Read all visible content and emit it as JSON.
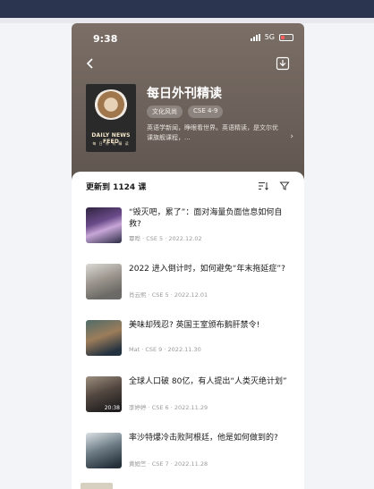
{
  "status_bar": {
    "time": "9:38",
    "network": "5G"
  },
  "book": {
    "title": "每日外刊精读",
    "tags": [
      "文化风尚",
      "CSE 4-9"
    ],
    "description": "英语学新闻，睁眼看世界。英语精读，是文尔优课旗舰课程，...",
    "cover_line1": "DAILY NEWS FEED",
    "cover_line2": "每 日 外 刊 精 读"
  },
  "sheet": {
    "update_label": "更新到 1124 课"
  },
  "episodes": [
    {
      "title": "“毁灭吧，累了”：面对海量负面信息如何自救?",
      "author": "覃晔",
      "level": "CSE 5",
      "date": "2022.12.02",
      "duration": ""
    },
    {
      "title": "2022 进入倒计时，如何避免“年末拖延症”?",
      "author": "肖云熙",
      "level": "CSE 5",
      "date": "2022.12.01",
      "duration": ""
    },
    {
      "title": "美味却残忍? 英国王室颁布鹅肝禁令!",
      "author": "Mat",
      "level": "CSE 9",
      "date": "2022.11.30",
      "duration": ""
    },
    {
      "title": "全球人口破 80亿，有人提出“人类灭绝计划”",
      "author": "李婷婷",
      "level": "CSE 6",
      "date": "2022.11.29",
      "duration": "20:38"
    },
    {
      "title": "率沙特爆冷击败阿根廷，他是如何做到的?",
      "author": "黄姮竺",
      "level": "CSE 7",
      "date": "2022.11.28",
      "duration": ""
    }
  ],
  "colors": {
    "hero": "#6c615a",
    "battery": "#ff5b5b",
    "page_bg": "#eceef2"
  },
  "icons": [
    "back-icon",
    "download-icon",
    "sort-icon",
    "filter-icon",
    "chevron-right-icon"
  ]
}
